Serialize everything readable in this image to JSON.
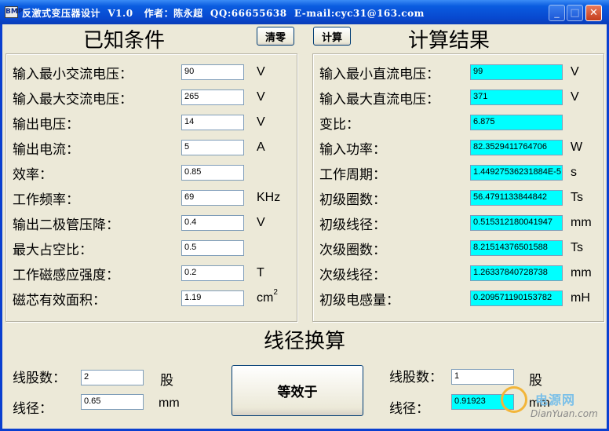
{
  "window": {
    "title": "反激式变压器设计  V1.0   作者：陈永超  QQ:66655638  E-mail:cyc31@163.com",
    "icon_text": "BMP",
    "controls": {
      "minimize": "_",
      "maximize": "□",
      "close": "✕"
    }
  },
  "known": {
    "heading": "已知条件",
    "clear_label": "清零",
    "rows": [
      {
        "label": "输入最小交流电压：",
        "value": "90",
        "unit": "V"
      },
      {
        "label": "输入最大交流电压：",
        "value": "265",
        "unit": "V"
      },
      {
        "label": "输出电压：",
        "value": "14",
        "unit": "V"
      },
      {
        "label": "输出电流：",
        "value": "5",
        "unit": "A"
      },
      {
        "label": "效率：",
        "value": "0.85",
        "unit": ""
      },
      {
        "label": "工作频率：",
        "value": "69",
        "unit": "KHz"
      },
      {
        "label": "输出二极管压降：",
        "value": "0.4",
        "unit": "V"
      },
      {
        "label": "最大占空比：",
        "value": "0.5",
        "unit": ""
      },
      {
        "label": "工作磁感应强度：",
        "value": "0.2",
        "unit": "T"
      },
      {
        "label": "磁芯有效面积：",
        "value": "1.19",
        "unit": "cm",
        "unit_sup": "2"
      }
    ]
  },
  "results": {
    "heading": "计算结果",
    "calc_label": "计算",
    "rows": [
      {
        "label": "输入最小直流电压：",
        "value": "99",
        "unit": "V"
      },
      {
        "label": "输入最大直流电压：",
        "value": "371",
        "unit": "V"
      },
      {
        "label": "变比：",
        "value": "6.875",
        "unit": ""
      },
      {
        "label": "输入功率：",
        "value": "82.3529411764706",
        "unit": "W"
      },
      {
        "label": "工作周期：",
        "value": "1.44927536231884E-5",
        "unit": "s"
      },
      {
        "label": "初级圈数：",
        "value": "56.4791133844842",
        "unit": "Ts"
      },
      {
        "label": "初级线径：",
        "value": "0.515312180041947",
        "unit": "mm"
      },
      {
        "label": "次级圈数：",
        "value": "8.21514376501588",
        "unit": "Ts"
      },
      {
        "label": "次级线径：",
        "value": "1.26337840728738",
        "unit": "mm"
      },
      {
        "label": "初级电感量：",
        "value": "0.209571190153782",
        "unit": "mH"
      }
    ]
  },
  "wire": {
    "heading": "线径换算",
    "equiv_label": "等效于",
    "left": {
      "strands_label": "线股数：",
      "strands_value": "2",
      "strands_unit": "股",
      "diameter_label": "线径：",
      "diameter_value": "0.65",
      "diameter_unit": "mm"
    },
    "right": {
      "strands_label": "线股数：",
      "strands_value": "1",
      "strands_unit": "股",
      "diameter_label": "线径：",
      "diameter_value": "0.91923",
      "diameter_unit": "mm"
    }
  },
  "watermark": {
    "main": "电源网",
    "sub": "DianYuan.com"
  }
}
